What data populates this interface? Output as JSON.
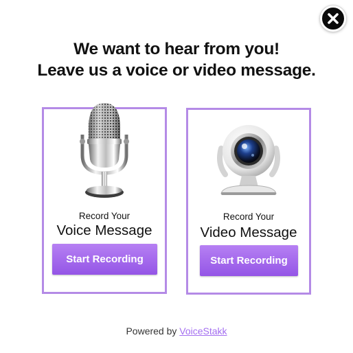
{
  "close": {
    "icon": "close-icon"
  },
  "headline": {
    "line1": "We want to hear from you!",
    "line2": "Leave us a voice or video message."
  },
  "voice_card": {
    "icon": "microphone-icon",
    "small_label": "Record Your",
    "big_label": "Voice Message",
    "button_label": "Start Recording"
  },
  "video_card": {
    "icon": "webcam-icon",
    "small_label": "Record Your",
    "big_label": "Video Message",
    "button_label": "Start Recording"
  },
  "footer": {
    "powered_text": "Powered by",
    "brand_link": "VoiceStakk"
  },
  "colors": {
    "accent": "#a46ff0",
    "card_border": "#b48ae6",
    "button_top": "#b680f3",
    "button_bottom": "#9455e6",
    "close_bg": "#0b0b0b"
  }
}
